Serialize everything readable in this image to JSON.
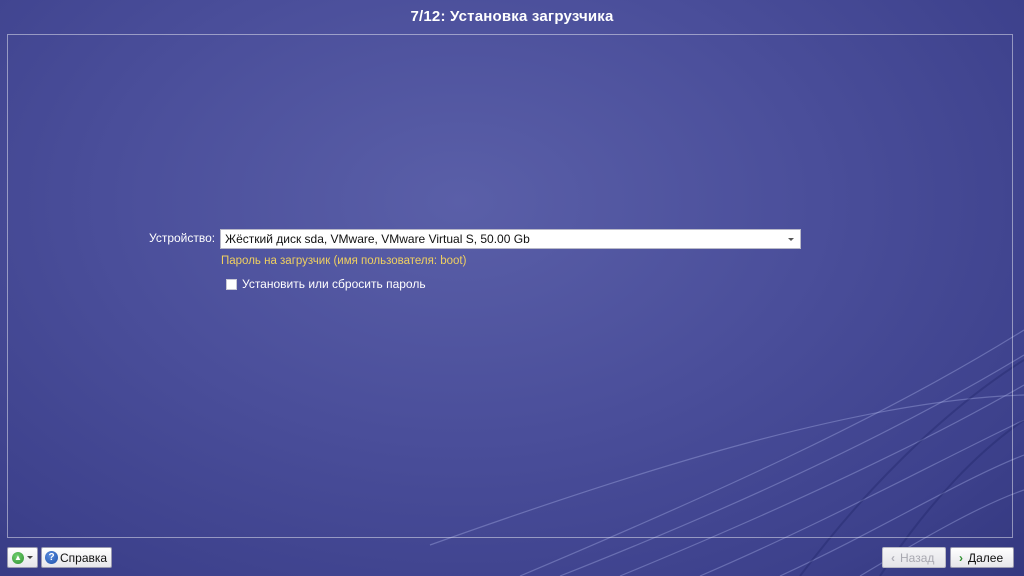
{
  "window": {
    "title": "7/12: Установка загрузчика"
  },
  "form": {
    "device_label": "Устройство:",
    "device_value": "Жёсткий диск sda, VMware, VMware Virtual S, 50.00 Gb",
    "password_section_label": "Пароль на загрузчик (имя пользователя: boot)",
    "set_password_checkbox": {
      "label": "Установить или сбросить пароль",
      "checked": false
    }
  },
  "footer": {
    "help_label": "Справка",
    "back_label": "Назад",
    "next_label": "Далее"
  },
  "icons": {
    "addon": "green-arrow-up-icon",
    "help": "help-question-icon",
    "back": "chevron-left-icon",
    "next": "chevron-right-icon",
    "dropdown": "dropdown-arrow-icon"
  },
  "colors": {
    "background": "#4a4e9a",
    "section_label": "#f0d060",
    "disabled_text": "#a8a8b0"
  }
}
